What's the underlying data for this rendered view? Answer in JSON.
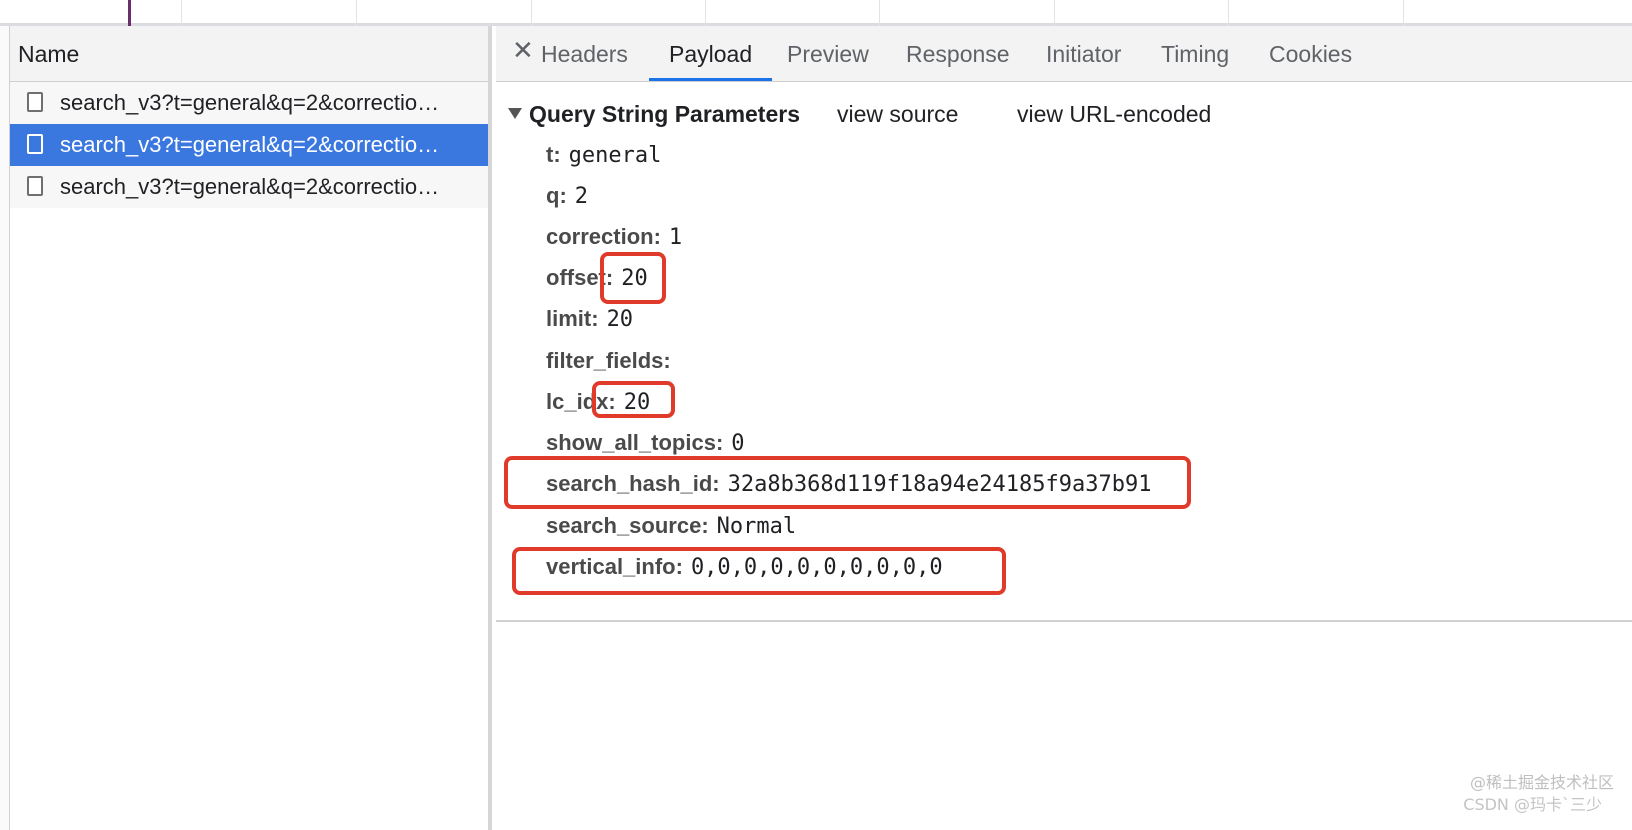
{
  "left_panel": {
    "header": "Name",
    "requests": [
      {
        "label": "search_v3?t=general&q=2&correctio…",
        "selected": false
      },
      {
        "label": "search_v3?t=general&q=2&correctio…",
        "selected": true
      },
      {
        "label": "search_v3?t=general&q=2&correctio…",
        "selected": false
      }
    ]
  },
  "tabs": {
    "close_icon": "✕",
    "items": [
      "Headers",
      "Payload",
      "Preview",
      "Response",
      "Initiator",
      "Timing",
      "Cookies"
    ],
    "active": "Payload"
  },
  "query_section": {
    "title": "Query String Parameters",
    "view_source": "view source",
    "view_url_encoded": "view URL-encoded"
  },
  "params": [
    {
      "key": "t:",
      "value": "general"
    },
    {
      "key": "q:",
      "value": "2"
    },
    {
      "key": "correction:",
      "value": "1"
    },
    {
      "key": "offset:",
      "value": "20"
    },
    {
      "key": "limit:",
      "value": "20"
    },
    {
      "key": "filter_fields:",
      "value": ""
    },
    {
      "key": "lc_idx:",
      "value": "20"
    },
    {
      "key": "show_all_topics:",
      "value": "0"
    },
    {
      "key": "search_hash_id:",
      "value": "32a8b368d119f18a94e24185f9a37b91"
    },
    {
      "key": "search_source:",
      "value": "Normal"
    },
    {
      "key": "vertical_info:",
      "value": "0,0,0,0,0,0,0,0,0,0"
    }
  ],
  "colors": {
    "highlight": "#e03a2a",
    "selected_row": "#3a78e0",
    "active_tab_underline": "#1a73e8"
  },
  "watermark": {
    "line1": "@稀土掘金技术社区",
    "line2": "CSDN @玛卡`三少"
  }
}
